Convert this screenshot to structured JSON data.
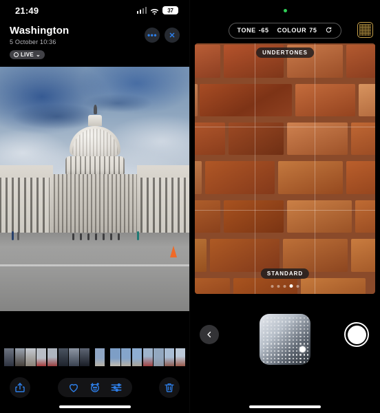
{
  "left_panel": {
    "status_bar": {
      "time": "21:49",
      "battery_level": "37",
      "cellular_icon": "cellular-bars-icon",
      "wifi_icon": "wifi-icon"
    },
    "header": {
      "title": "Washington",
      "subtitle": "5 October  10:36",
      "live_badge": "LIVE",
      "more_label": "•••",
      "close_label": "✕"
    },
    "photo": {
      "alt_name": "us-capitol-photo"
    },
    "filmstrip": {
      "thumbs": [
        "#6d7481",
        "#8b8f97",
        "#b9bec6",
        "#a63b3b",
        "#9b4040",
        "#4a5360",
        "#7d8591",
        "#3a4250",
        "#aab3c0",
        "#9aa6b6",
        "#b3bcc8",
        "#8e97a5",
        "#7c8594",
        "#a04242",
        "#8e5a4f"
      ]
    },
    "toolbar": {
      "share_label": "share-icon",
      "favourite_label": "heart-icon",
      "cleanup_label": "cleanup-icon",
      "adjust_label": "adjust-icon",
      "delete_label": "trash-icon"
    }
  },
  "right_panel": {
    "recording_dot": "green-privacy-dot",
    "controls": {
      "tone_label": "TONE",
      "tone_value": "-65",
      "colour_label": "COLOUR",
      "colour_value": "75",
      "reset_icon": "reset-icon",
      "styles_icon": "photographic-styles-icon"
    },
    "preview": {
      "top_style": "UNDERTONES",
      "bottom_style": "STANDARD",
      "page_dots": 5,
      "active_dot": 3,
      "grid_overlay": true
    },
    "bottom": {
      "back_icon": "chevron-left-icon",
      "pad_name": "tone-colour-pad",
      "shutter_label": "shutter-button"
    }
  },
  "colors": {
    "accent_blue": "#2e7fe8",
    "styles_gold": "#c8a14a",
    "privacy_green": "#30d158",
    "background": "#000000"
  }
}
